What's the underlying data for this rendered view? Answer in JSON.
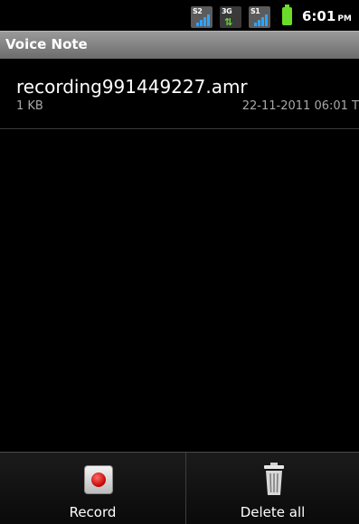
{
  "status_bar": {
    "sim1_label": "S2",
    "sim2_label": "3G",
    "sim3_label": "S1",
    "time": "6:01",
    "ampm": "PM",
    "battery_color": "#6bdc2a"
  },
  "app": {
    "title": "Voice Note"
  },
  "recordings": [
    {
      "name": "recording991449227.amr",
      "size": "1 KB",
      "date": "22-11-2011 06:01 T"
    }
  ],
  "bottom_bar": {
    "record_label": "Record",
    "delete_all_label": "Delete all"
  },
  "icons": {
    "record": "record-icon",
    "delete_all": "trash-icon",
    "battery": "battery-icon",
    "signal": "signal-icon"
  },
  "colors": {
    "background": "#000000",
    "titlebar": "#8a8a8a",
    "secondary_text": "#a8a8a8",
    "record_red": "#c40000"
  }
}
